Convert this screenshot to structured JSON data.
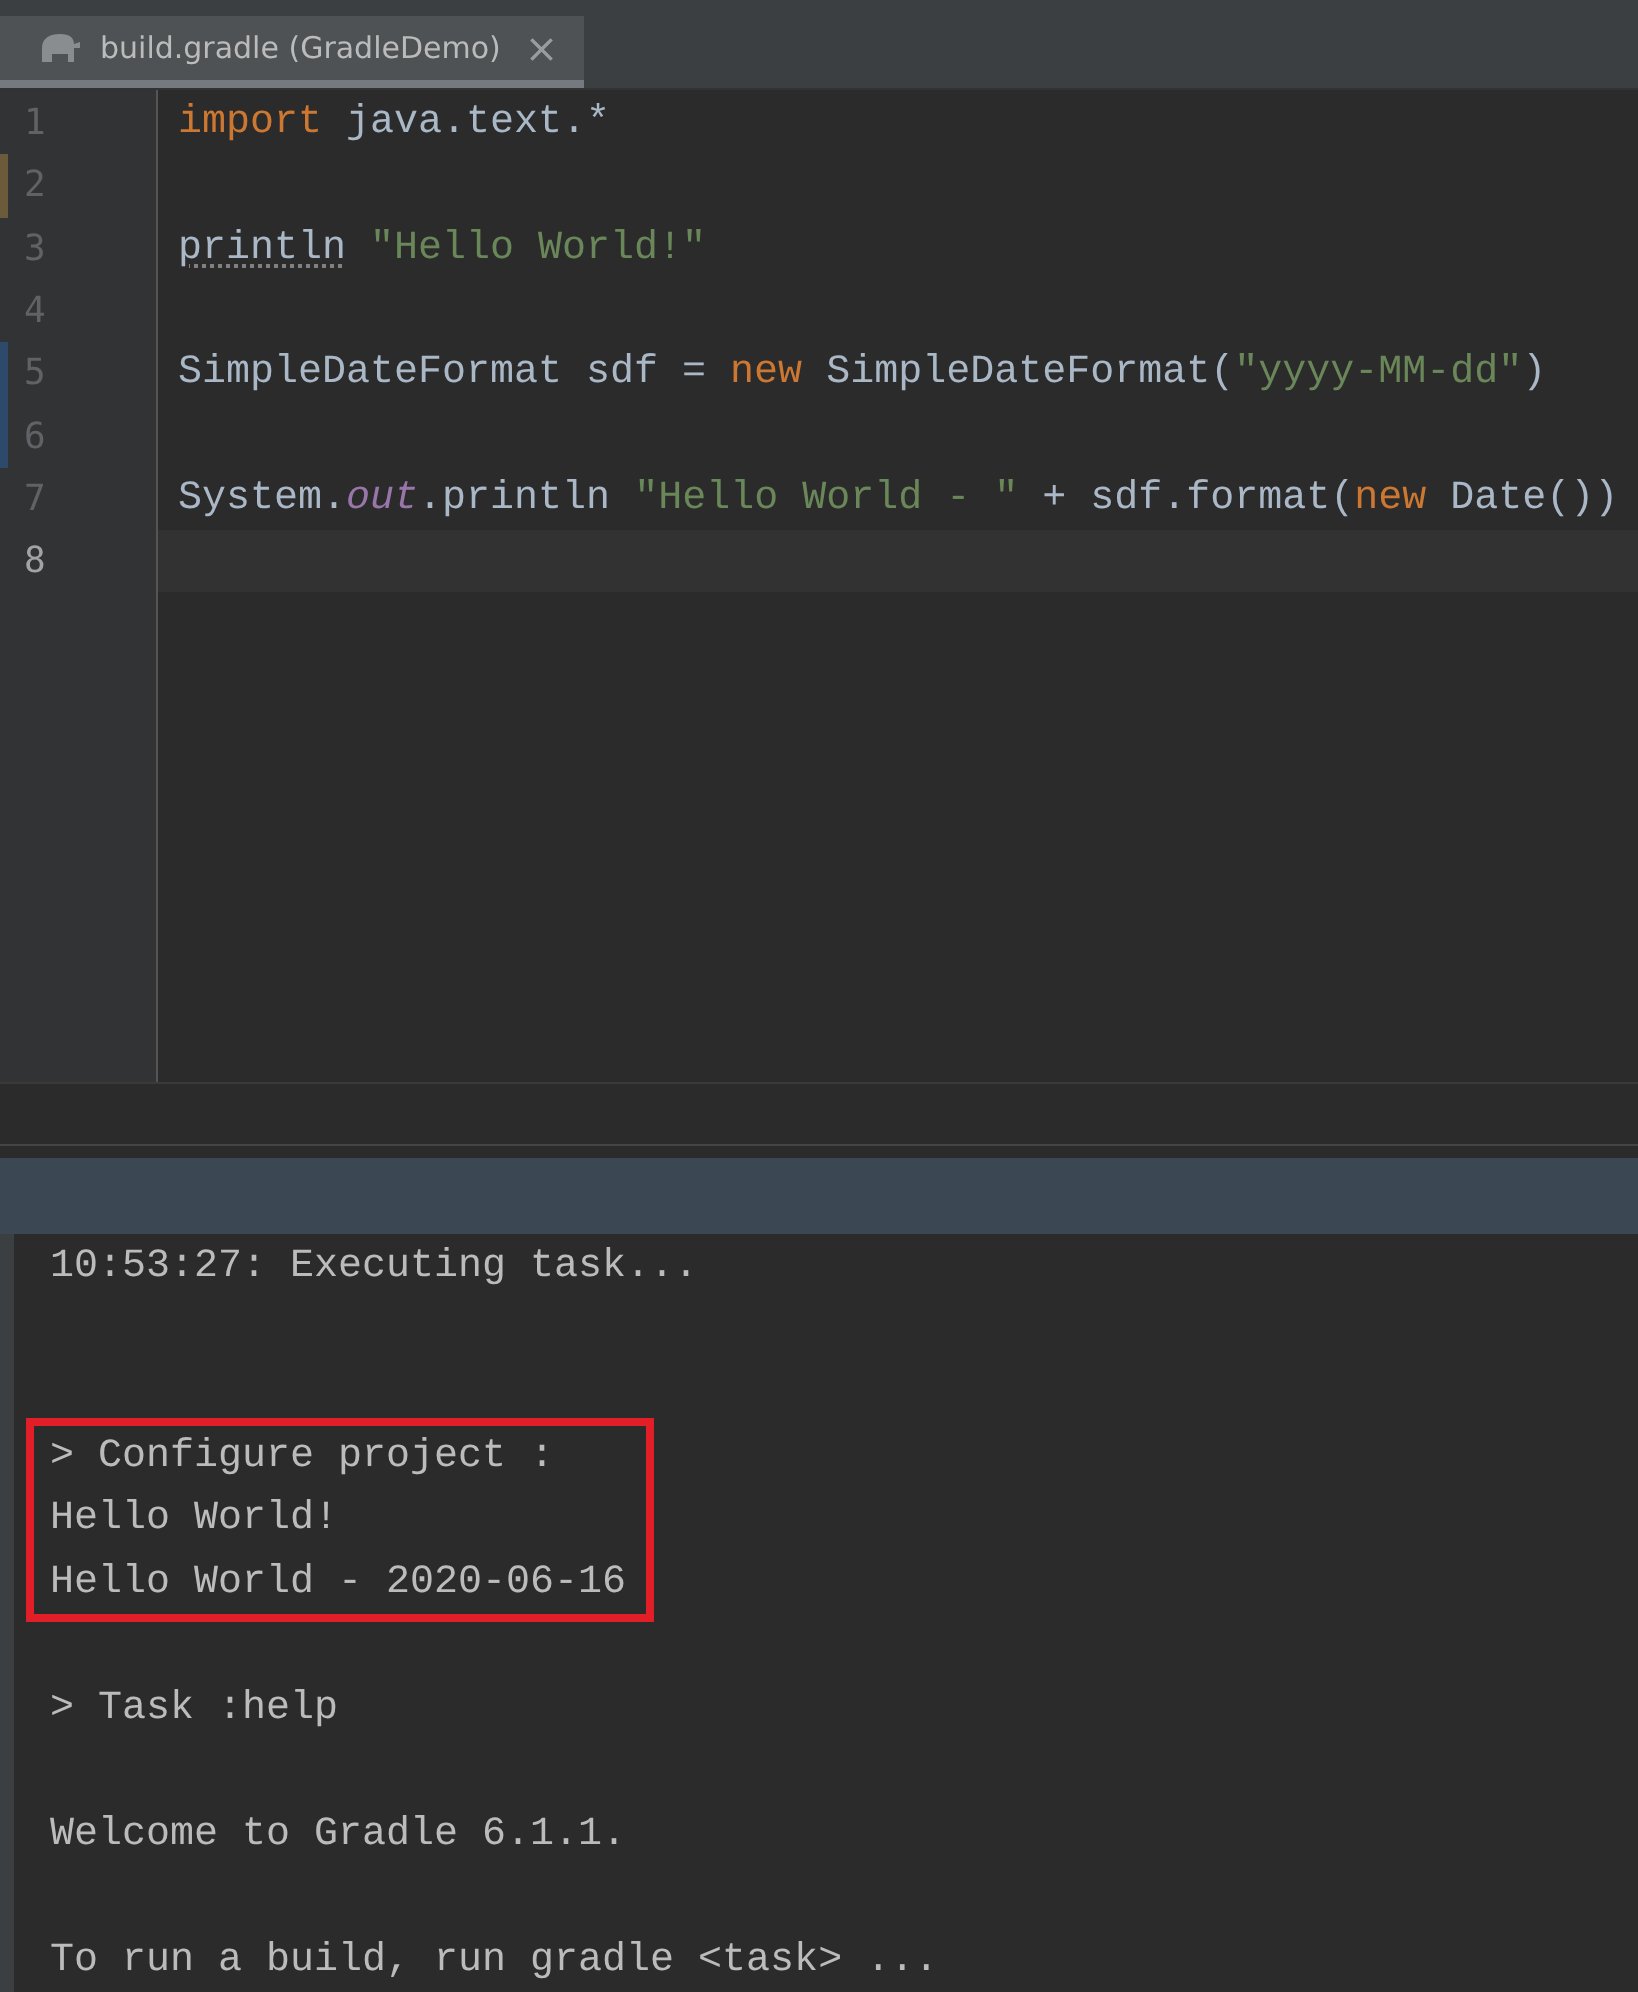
{
  "tab": {
    "title": "build.gradle (GradleDemo)",
    "close": "×",
    "selected": true
  },
  "editor": {
    "lines": [
      {
        "number": "1",
        "current": false,
        "kind": "plain",
        "tokens": [
          {
            "kind": "keyword",
            "text": "import"
          },
          {
            "kind": "plain",
            "text": " java.text.*"
          }
        ]
      },
      {
        "number": "2",
        "current": false,
        "kind": "modified"
      },
      {
        "number": "3",
        "current": false,
        "kind": "plain",
        "tokens": [
          {
            "kind": "warning",
            "text": "println"
          },
          {
            "kind": "string",
            "text": " \"Hello World!\""
          }
        ]
      },
      {
        "number": "4",
        "current": false,
        "kind": "plain"
      },
      {
        "number": "5",
        "current": false,
        "kind": "added",
        "tokens": [
          {
            "kind": "plain",
            "text": "SimpleDateFormat sdf = "
          },
          {
            "kind": "keyword",
            "text": "new"
          },
          {
            "kind": "plain",
            "text": " SimpleDateFormat("
          },
          {
            "kind": "string",
            "text": "\"yyyy-MM-dd\""
          },
          {
            "kind": "plain",
            "text": ")"
          }
        ]
      },
      {
        "number": "6",
        "current": false,
        "kind": "added"
      },
      {
        "number": "7",
        "current": false,
        "kind": "plain",
        "tokens": [
          {
            "kind": "plain",
            "text": "System."
          },
          {
            "kind": "field",
            "text": "out"
          },
          {
            "kind": "plain",
            "text": ".println "
          },
          {
            "kind": "string",
            "text": "\"Hello World - \""
          },
          {
            "kind": "plain",
            "text": " + sdf.format("
          },
          {
            "kind": "keyword",
            "text": "new"
          },
          {
            "kind": "plain",
            "text": " Date())"
          }
        ]
      },
      {
        "number": "8",
        "current": true,
        "kind": "plain"
      }
    ]
  },
  "console": {
    "blocks": [
      {
        "highlighted": false,
        "lines": [
          "10:53:27: Executing task..."
        ]
      },
      {
        "highlighted": true,
        "lines": [
          "> Configure project :",
          "Hello World!",
          "Hello World - 2020-06-16"
        ]
      },
      {
        "highlighted": false,
        "lines": [
          "> Task :help"
        ]
      },
      {
        "highlighted": false,
        "lines": [
          "Welcome to Gradle 6.1.1."
        ]
      },
      {
        "highlighted": false,
        "lines": [
          "To run a build, run gradle <task> ..."
        ]
      }
    ]
  }
}
